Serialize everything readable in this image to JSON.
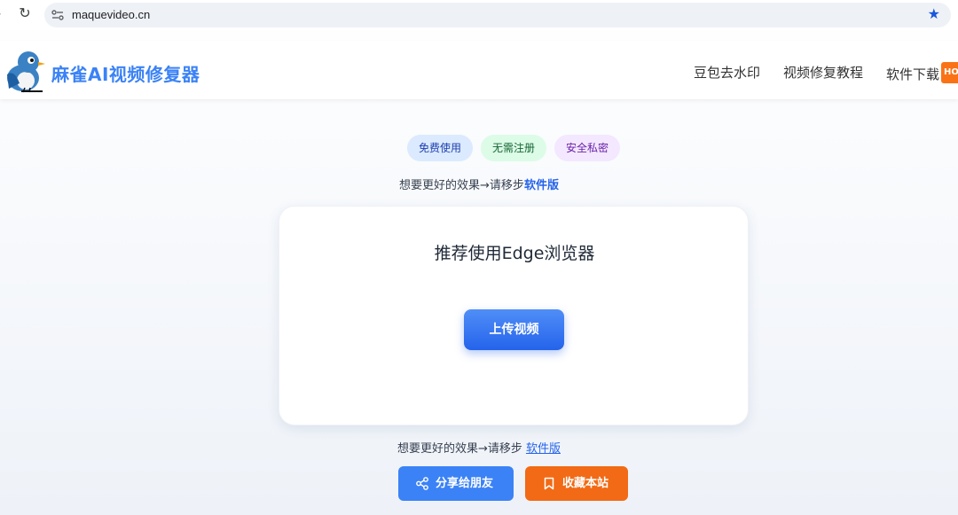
{
  "browser": {
    "url": "maquevideo.cn"
  },
  "header": {
    "brand": "麻雀AI视频修复器",
    "nav": [
      {
        "label": "豆包去水印"
      },
      {
        "label": "视频修复教程"
      },
      {
        "label": "软件下载"
      }
    ],
    "hot_badge": "HO"
  },
  "badges": [
    "免费使用",
    "无需注册",
    "安全私密"
  ],
  "hint_top": {
    "text": "想要更好的效果→请移步",
    "link": "软件版"
  },
  "card": {
    "title": "推荐使用Edge浏览器",
    "upload_label": "上传视频"
  },
  "hint_bottom": {
    "text": "想要更好的效果→请移步",
    "link": "软件版"
  },
  "actions": {
    "share_label": "分享给朋友",
    "favorite_label": "收藏本站"
  },
  "colors": {
    "accent": "#3b82f6",
    "orange": "#f26a15"
  }
}
